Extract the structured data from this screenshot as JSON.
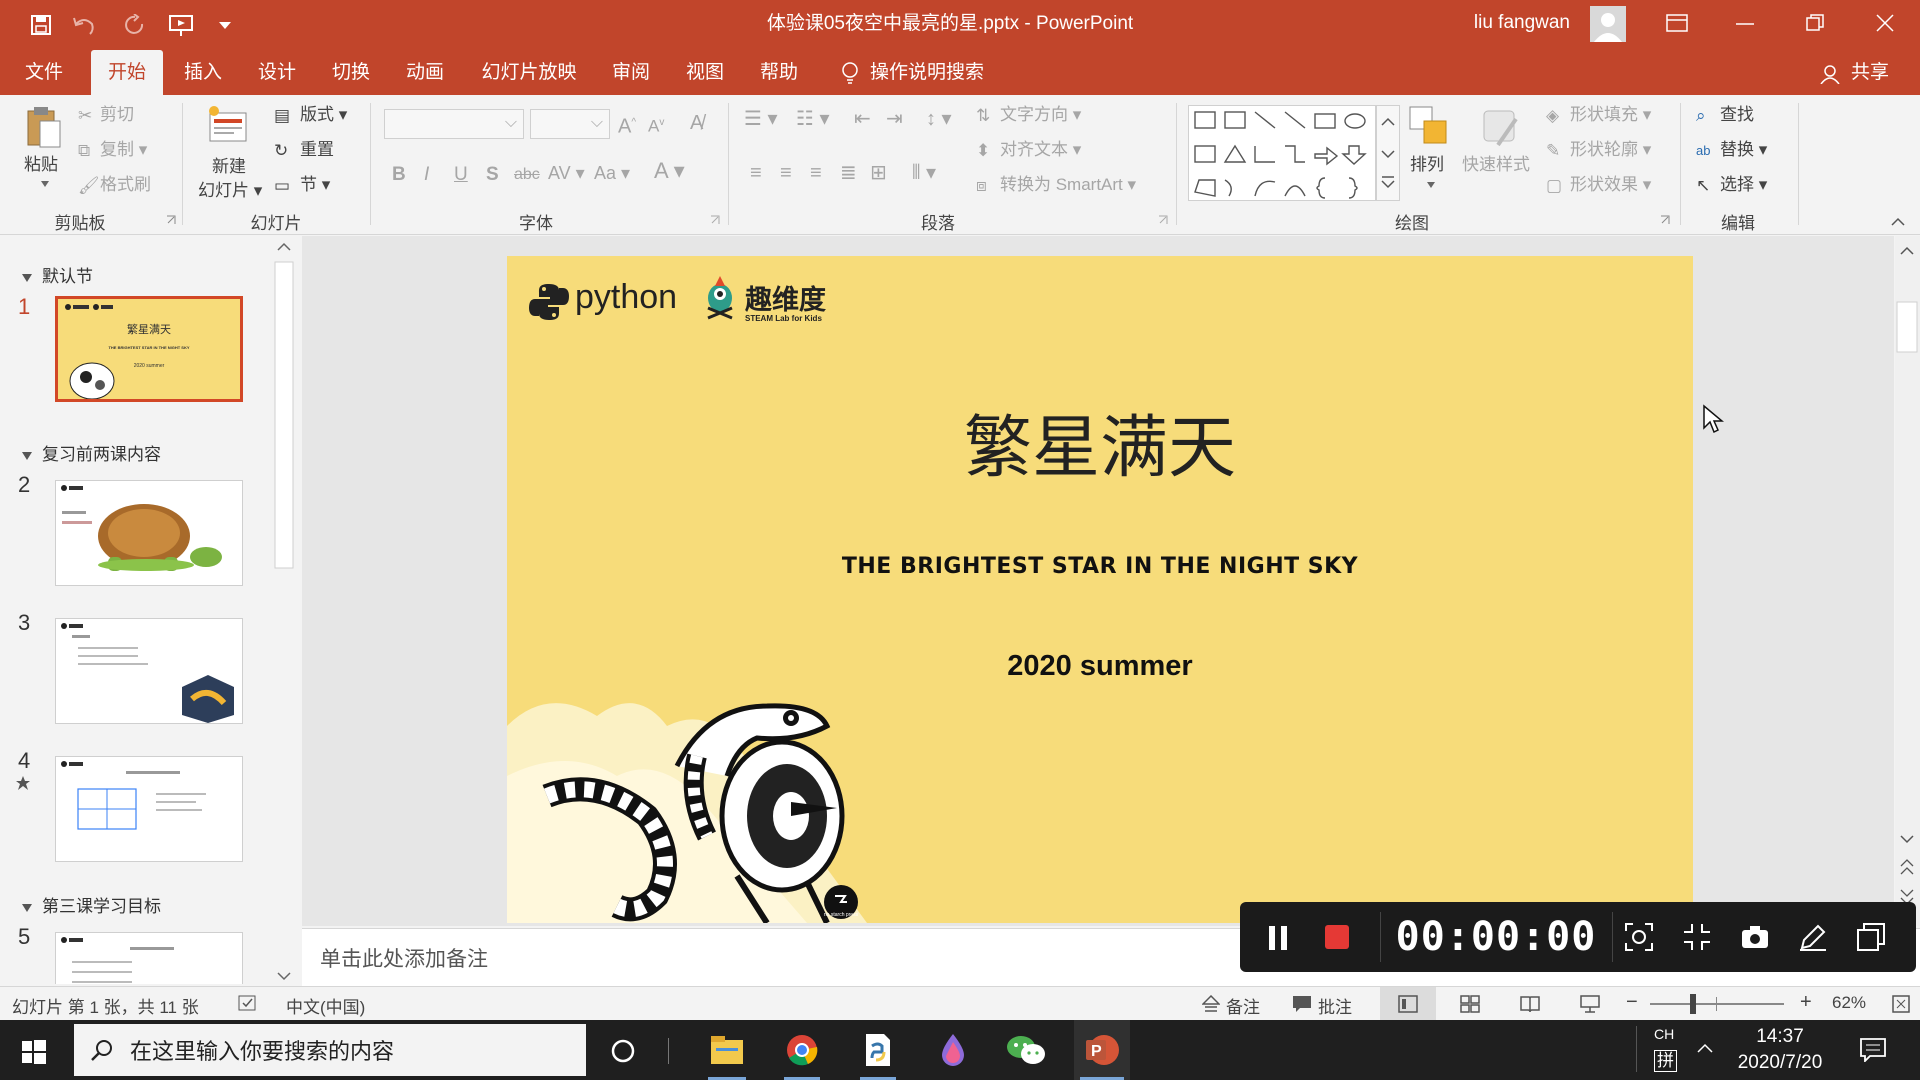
{
  "window": {
    "title": "体验课05夜空中最亮的星.pptx  -  PowerPoint",
    "user": "liu fangwan"
  },
  "tabs": [
    "文件",
    "开始",
    "插入",
    "设计",
    "切换",
    "动画",
    "幻灯片放映",
    "审阅",
    "视图",
    "帮助"
  ],
  "active_tab": "开始",
  "tell_me": "操作说明搜索",
  "share": "共享",
  "ribbon": {
    "clipboard": {
      "label": "剪贴板",
      "paste": "粘贴",
      "cut": "剪切",
      "copy": "复制",
      "format_painter": "格式刷"
    },
    "slides": {
      "label": "幻灯片",
      "new_slide_1": "新建",
      "new_slide_2": "幻灯片",
      "layout": "版式",
      "reset": "重置",
      "section": "节"
    },
    "font": {
      "label": "字体"
    },
    "paragraph": {
      "label": "段落",
      "text_direction": "文字方向",
      "align_text": "对齐文本",
      "convert_smartart": "转换为 SmartArt"
    },
    "drawing": {
      "label": "绘图",
      "arrange": "排列",
      "quick_styles": "快速样式",
      "shape_fill": "形状填充",
      "shape_outline": "形状轮廓",
      "shape_effects": "形状效果"
    },
    "editing": {
      "label": "编辑",
      "find": "查找",
      "replace": "替换",
      "select": "选择"
    }
  },
  "slide_pane": {
    "sections": [
      "默认节",
      "复习前两课内容",
      "第三课学习目标"
    ],
    "slide_numbers": [
      "1",
      "2",
      "3",
      "4",
      "5"
    ]
  },
  "slide": {
    "python_logo": "python",
    "brand": "趣维度",
    "brand_sub": "STEAM Lab for Kids",
    "title": "繁星满天",
    "subtitle": "THE BRIGHTEST STAR IN THE NIGHT SKY",
    "date": "2020 summer",
    "nostarch": "no starch press"
  },
  "thumb1": {
    "title": "繁星满天",
    "sub": "THE BRIGHTEST STAR IN THE NIGHT SKY",
    "date": "2020 summer"
  },
  "notes_placeholder": "单击此处添加备注",
  "status": {
    "slide_info": "幻灯片 第 1 张，共 11 张",
    "language": "中文(中国)",
    "notes": "备注",
    "comments": "批注",
    "zoom": "62%"
  },
  "recorder": {
    "time": "00:00:00"
  },
  "taskbar": {
    "search_placeholder": "在这里输入你要搜索的内容",
    "ime_ch": "CH",
    "ime_mode": "拼",
    "time": "14:37",
    "date": "2020/7/20"
  },
  "colors": {
    "accent": "#c1452b",
    "slide_bg": "#f7dc7a"
  }
}
